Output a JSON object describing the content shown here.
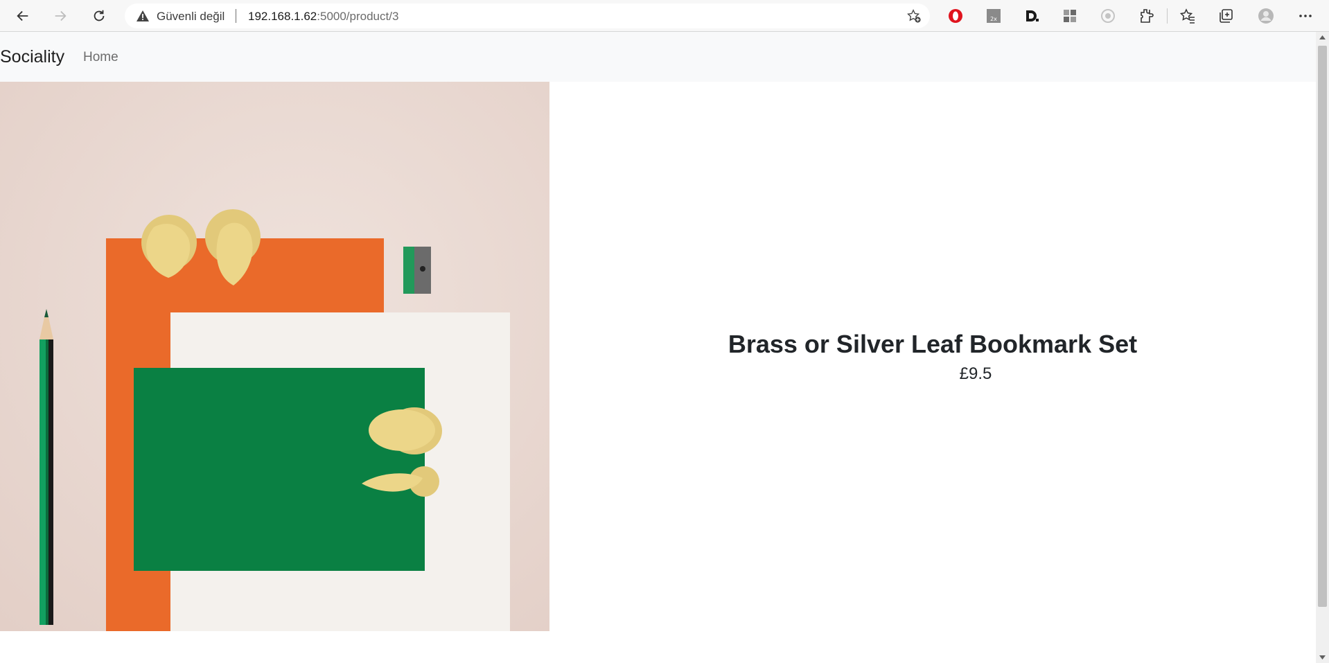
{
  "browser": {
    "security_label": "Güvenli değil",
    "url_host": "192.168.1.62",
    "url_rest": ":5000/product/3",
    "icons": [
      "back-icon",
      "forward-icon",
      "refresh-icon",
      "warning-icon",
      "add-favorite-icon",
      "opera-icon",
      "translate-extension-icon",
      "dashlane-icon",
      "grid-extension-icon",
      "camera-extension-icon",
      "extensions-icon",
      "favorites-icon",
      "collections-icon",
      "profile-icon",
      "more-icon"
    ]
  },
  "navbar": {
    "brand": "Sociality",
    "home_link": "Home"
  },
  "product": {
    "title": "Brass or Silver Leaf Bookmark Set",
    "price": "£9.5"
  },
  "colors": {
    "navbar_bg": "#f8f9fa",
    "image_bg": "#ead9d2",
    "orange": "#ea6a2a",
    "green": "#0a8043",
    "brass": "#e9d483"
  }
}
